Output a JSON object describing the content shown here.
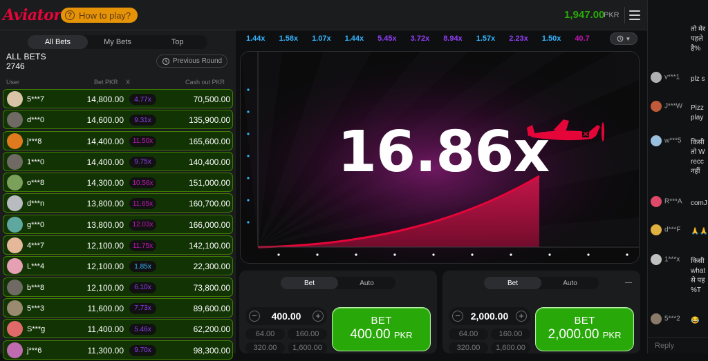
{
  "header": {
    "logo": "Aviator",
    "how_to_play": "How to play?",
    "balance": "1,947.00",
    "currency": "PKR"
  },
  "bets_panel": {
    "tabs": [
      "All Bets",
      "My Bets",
      "Top"
    ],
    "active_tab": "All Bets",
    "title": "ALL BETS",
    "count": "2746",
    "previous_round": "Previous Round",
    "columns": {
      "user": "User",
      "bet": "Bet PKR",
      "x": "X",
      "cashout": "Cash out PKR"
    },
    "rows": [
      {
        "user": "5***7",
        "bet": "14,800.00",
        "mult": "4.77x",
        "cashout": "70,500.00",
        "avatar": "#d9c4a8",
        "mult_color": "#913ef8"
      },
      {
        "user": "d***0",
        "bet": "14,600.00",
        "mult": "9.31x",
        "cashout": "135,900.00",
        "avatar": "#6f6a64",
        "mult_color": "#913ef8"
      },
      {
        "user": "j***8",
        "bet": "14,400.00",
        "mult": "11.50x",
        "cashout": "165,600.00",
        "avatar": "#e07a1e",
        "mult_color": "#c017b4"
      },
      {
        "user": "1***0",
        "bet": "14,400.00",
        "mult": "9.75x",
        "cashout": "140,400.00",
        "avatar": "#6f6a64",
        "mult_color": "#913ef8"
      },
      {
        "user": "o***8",
        "bet": "14,300.00",
        "mult": "10.56x",
        "cashout": "151,000.00",
        "avatar": "#7aa05a",
        "mult_color": "#c017b4"
      },
      {
        "user": "d***n",
        "bet": "13,800.00",
        "mult": "11.65x",
        "cashout": "160,700.00",
        "avatar": "#b8bcc0",
        "mult_color": "#c017b4"
      },
      {
        "user": "g***0",
        "bet": "13,800.00",
        "mult": "12.03x",
        "cashout": "166,000.00",
        "avatar": "#5fa8a0",
        "mult_color": "#c017b4"
      },
      {
        "user": "4***7",
        "bet": "12,100.00",
        "mult": "11.75x",
        "cashout": "142,100.00",
        "avatar": "#e6b89a",
        "mult_color": "#c017b4"
      },
      {
        "user": "L***4",
        "bet": "12,100.00",
        "mult": "1.85x",
        "cashout": "22,300.00",
        "avatar": "#e6a0b4",
        "mult_color": "#34b4ff"
      },
      {
        "user": "b***8",
        "bet": "12,100.00",
        "mult": "6.10x",
        "cashout": "73,800.00",
        "avatar": "#6f6a64",
        "mult_color": "#913ef8"
      },
      {
        "user": "5***3",
        "bet": "11,600.00",
        "mult": "7.73x",
        "cashout": "89,600.00",
        "avatar": "#9a8a70",
        "mult_color": "#913ef8"
      },
      {
        "user": "S***g",
        "bet": "11,400.00",
        "mult": "5.46x",
        "cashout": "62,200.00",
        "avatar": "#e06a6a",
        "mult_color": "#913ef8"
      },
      {
        "user": "j***6",
        "bet": "11,300.00",
        "mult": "9.70x",
        "cashout": "98,300.00",
        "avatar": "#c06ab0",
        "mult_color": "#913ef8"
      }
    ]
  },
  "history": {
    "items": [
      {
        "v": "1.44x",
        "c": "#34b4ff"
      },
      {
        "v": "1.58x",
        "c": "#34b4ff"
      },
      {
        "v": "1.07x",
        "c": "#34b4ff"
      },
      {
        "v": "1.44x",
        "c": "#34b4ff"
      },
      {
        "v": "5.45x",
        "c": "#913ef8"
      },
      {
        "v": "3.72x",
        "c": "#913ef8"
      },
      {
        "v": "8.94x",
        "c": "#913ef8"
      },
      {
        "v": "1.57x",
        "c": "#34b4ff"
      },
      {
        "v": "2.23x",
        "c": "#913ef8"
      },
      {
        "v": "1.50x",
        "c": "#34b4ff"
      },
      {
        "v": "40.7",
        "c": "#c017b4"
      }
    ],
    "toggle_icons": "clock-icon"
  },
  "game": {
    "multiplier": "16.86x"
  },
  "bet_panels": [
    {
      "tabs": [
        "Bet",
        "Auto"
      ],
      "stake": "400.00",
      "quick": [
        "64.00",
        "160.00",
        "320.00",
        "1,600.00"
      ],
      "button_label": "BET",
      "button_amount": "400.00",
      "button_currency": "PKR"
    },
    {
      "tabs": [
        "Bet",
        "Auto"
      ],
      "stake": "2,000.00",
      "quick": [
        "64.00",
        "160.00",
        "320.00",
        "1,600.00"
      ],
      "button_label": "BET",
      "button_amount": "2,000.00",
      "button_currency": "PKR"
    }
  ],
  "chat": {
    "messages": [
      {
        "user": "",
        "lines": [
          "तो मेर",
          "पहले",
          "है%"
        ]
      },
      {
        "user": "v***1",
        "lines": [
          "plz s"
        ]
      },
      {
        "user": "J***W",
        "lines": [
          "Pizz",
          "play"
        ]
      },
      {
        "user": "w***5",
        "lines": [
          "किसी",
          "तो W",
          "recc",
          "नहीं"
        ]
      },
      {
        "user": "R***A",
        "lines": [
          "comJ"
        ]
      },
      {
        "user": "d***F",
        "lines": [
          "🙏🙏"
        ]
      },
      {
        "user": "1***x",
        "lines": [
          "किसी",
          "what",
          "से पह",
          "%T"
        ]
      },
      {
        "user": "5***2",
        "lines": [
          "😂"
        ]
      }
    ],
    "reply_placeholder": "Reply"
  }
}
